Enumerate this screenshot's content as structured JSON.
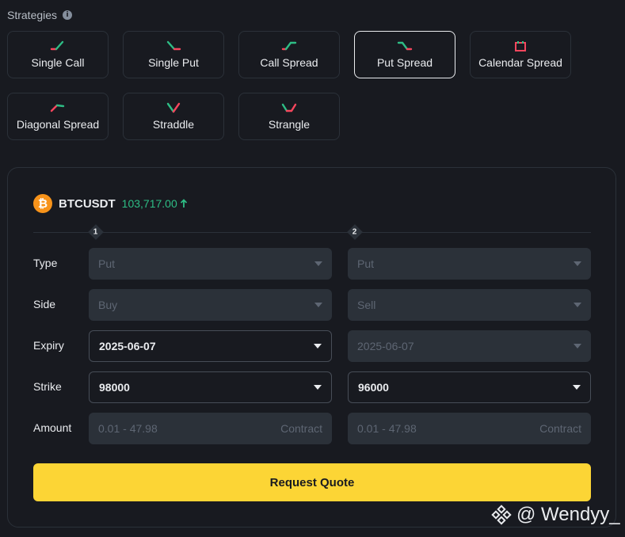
{
  "strategies": {
    "title": "Strategies",
    "items": [
      {
        "label": "Single Call",
        "icon": "single-call-icon"
      },
      {
        "label": "Single Put",
        "icon": "single-put-icon"
      },
      {
        "label": "Call Spread",
        "icon": "call-spread-icon"
      },
      {
        "label": "Put Spread",
        "icon": "put-spread-icon",
        "selected": true
      },
      {
        "label": "Calendar Spread",
        "icon": "calendar-spread-icon"
      },
      {
        "label": "Diagonal Spread",
        "icon": "diagonal-spread-icon"
      },
      {
        "label": "Straddle",
        "icon": "straddle-icon"
      },
      {
        "label": "Strangle",
        "icon": "strangle-icon"
      }
    ]
  },
  "ticker": {
    "symbol": "BTCUSDT",
    "price": "103,717.00",
    "direction": "up"
  },
  "legs": [
    "1",
    "2"
  ],
  "form": {
    "labels": {
      "type": "Type",
      "side": "Side",
      "expiry": "Expiry",
      "strike": "Strike",
      "amount": "Amount"
    },
    "leg1": {
      "type": "Put",
      "side": "Buy",
      "expiry": "2025-06-07",
      "strike": "98000",
      "amount_placeholder": "0.01 - 47.98",
      "amount_unit": "Contract"
    },
    "leg2": {
      "type": "Put",
      "side": "Sell",
      "expiry": "2025-06-07",
      "strike": "96000",
      "amount_placeholder": "0.01 - 47.98",
      "amount_unit": "Contract"
    }
  },
  "submit_label": "Request Quote",
  "watermark": "@ Wendyy_",
  "colors": {
    "up": "#2ebd85",
    "down": "#f6465d",
    "accent": "#fcd535",
    "background": "#181a20",
    "border": "#2b3139"
  }
}
